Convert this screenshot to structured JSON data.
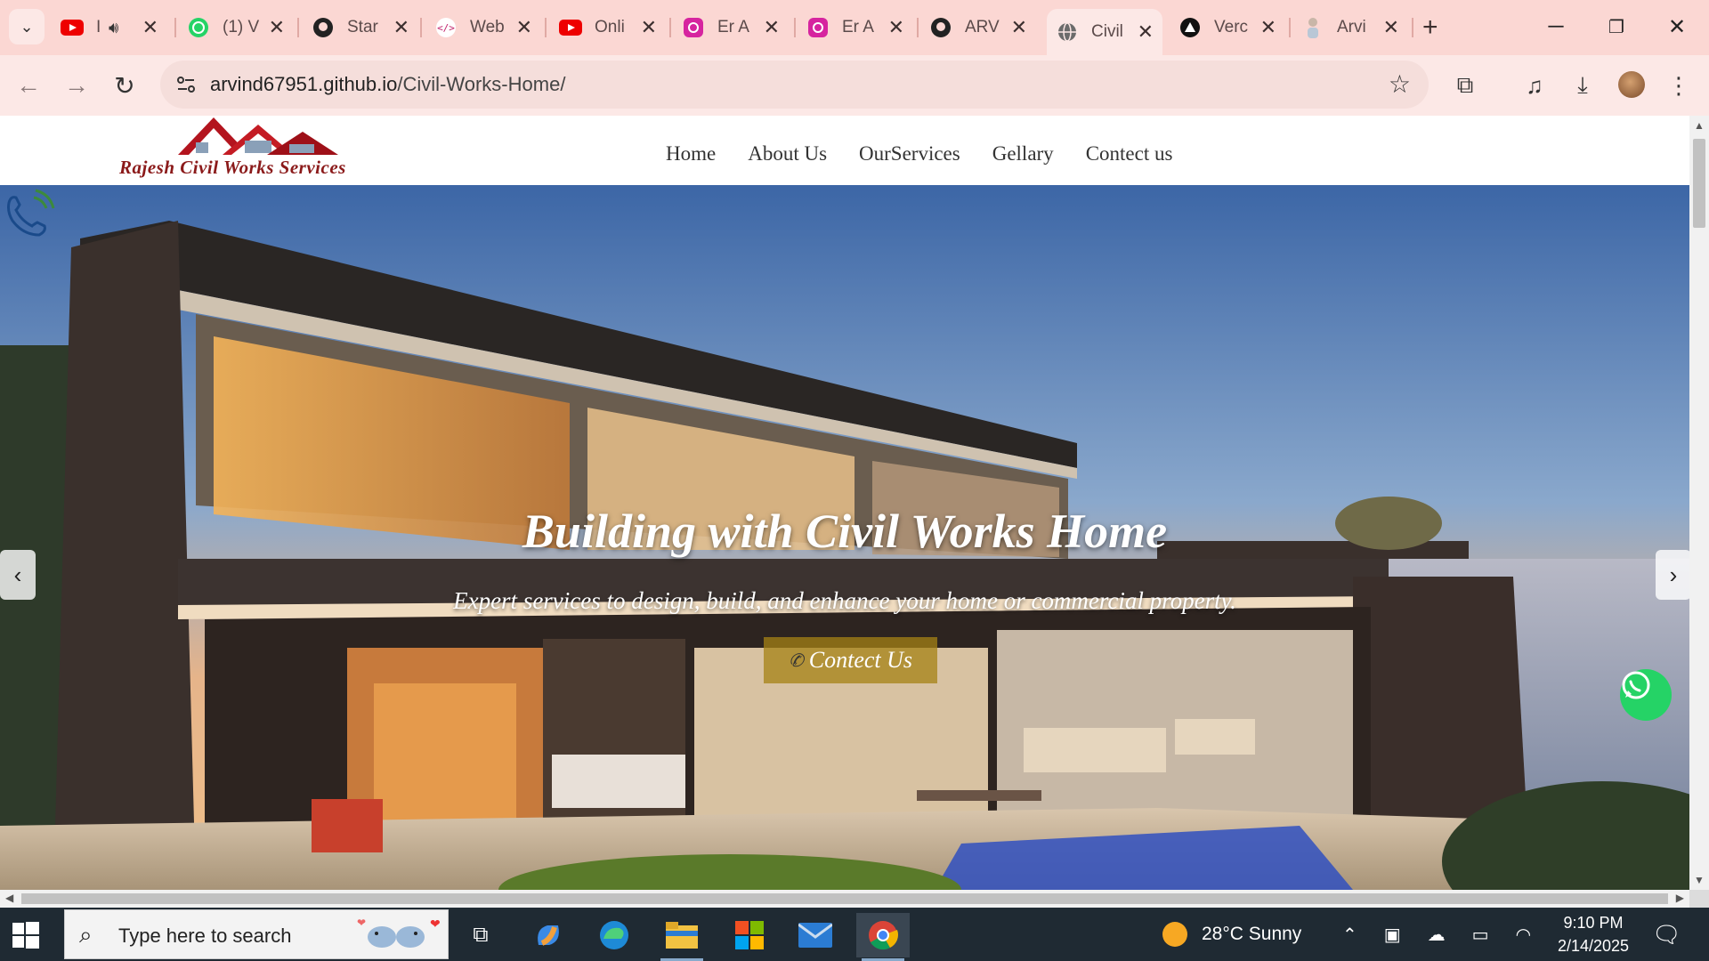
{
  "browser": {
    "tabs": [
      {
        "title": "I",
        "icon": "youtube-icon",
        "muted": true
      },
      {
        "title": "(1) V",
        "icon": "whatsapp-icon"
      },
      {
        "title": "Star",
        "icon": "github-icon"
      },
      {
        "title": "Web",
        "icon": "code-icon"
      },
      {
        "title": "Onli",
        "icon": "youtube-icon"
      },
      {
        "title": "Er A",
        "icon": "instagram-icon"
      },
      {
        "title": "Er A",
        "icon": "instagram-icon"
      },
      {
        "title": "ARV",
        "icon": "github-icon"
      },
      {
        "title": "Civil",
        "icon": "globe-icon",
        "active": true
      },
      {
        "title": "Verc",
        "icon": "vercel-icon"
      },
      {
        "title": "Arvi",
        "icon": "person-icon"
      }
    ],
    "url_host": "arvind67951.github.io",
    "url_path": "/Civil-Works-Home/"
  },
  "site": {
    "logo_text": "Rajesh Civil Works Services",
    "nav": [
      "Home",
      "About Us",
      "OurServices",
      "Gellary",
      "Contect us"
    ],
    "hero": {
      "title": "Building with Civil Works Home",
      "subtitle": "Expert services to design, build, and enhance your home or commercial property.",
      "cta": "Contect Us"
    }
  },
  "taskbar": {
    "search_placeholder": "Type here to search",
    "weather": "28°C  Sunny",
    "time": "9:10 PM",
    "date": "2/14/2025"
  },
  "colors": {
    "tabstrip": "#fbd7d3",
    "toolbar": "#fce8e6",
    "logo_red": "#8b1a1a",
    "cta_gold": "#a58214",
    "whatsapp": "#25d366"
  }
}
